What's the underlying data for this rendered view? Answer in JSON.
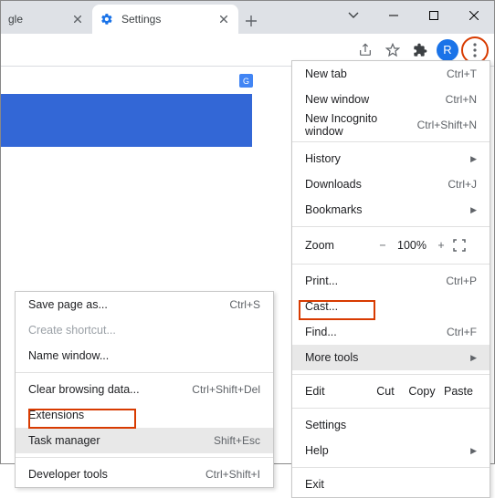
{
  "tabs": {
    "inactive_title": "gle",
    "active_title": "Settings"
  },
  "avatar_letter": "R",
  "g_badge": "G",
  "main_menu": {
    "new_tab": "New tab",
    "new_tab_sc": "Ctrl+T",
    "new_window": "New window",
    "new_window_sc": "Ctrl+N",
    "incognito": "New Incognito window",
    "incognito_sc": "Ctrl+Shift+N",
    "history": "History",
    "downloads": "Downloads",
    "downloads_sc": "Ctrl+J",
    "bookmarks": "Bookmarks",
    "zoom": "Zoom",
    "zoom_val": "100%",
    "print": "Print...",
    "print_sc": "Ctrl+P",
    "cast": "Cast...",
    "find": "Find...",
    "find_sc": "Ctrl+F",
    "more_tools": "More tools",
    "edit": "Edit",
    "cut": "Cut",
    "copy": "Copy",
    "paste": "Paste",
    "settings": "Settings",
    "help": "Help",
    "exit": "Exit"
  },
  "sub_menu": {
    "save_page": "Save page as...",
    "save_page_sc": "Ctrl+S",
    "create_shortcut": "Create shortcut...",
    "name_window": "Name window...",
    "clear_data": "Clear browsing data...",
    "clear_data_sc": "Ctrl+Shift+Del",
    "extensions": "Extensions",
    "task_manager": "Task manager",
    "task_manager_sc": "Shift+Esc",
    "dev_tools": "Developer tools",
    "dev_tools_sc": "Ctrl+Shift+I"
  }
}
